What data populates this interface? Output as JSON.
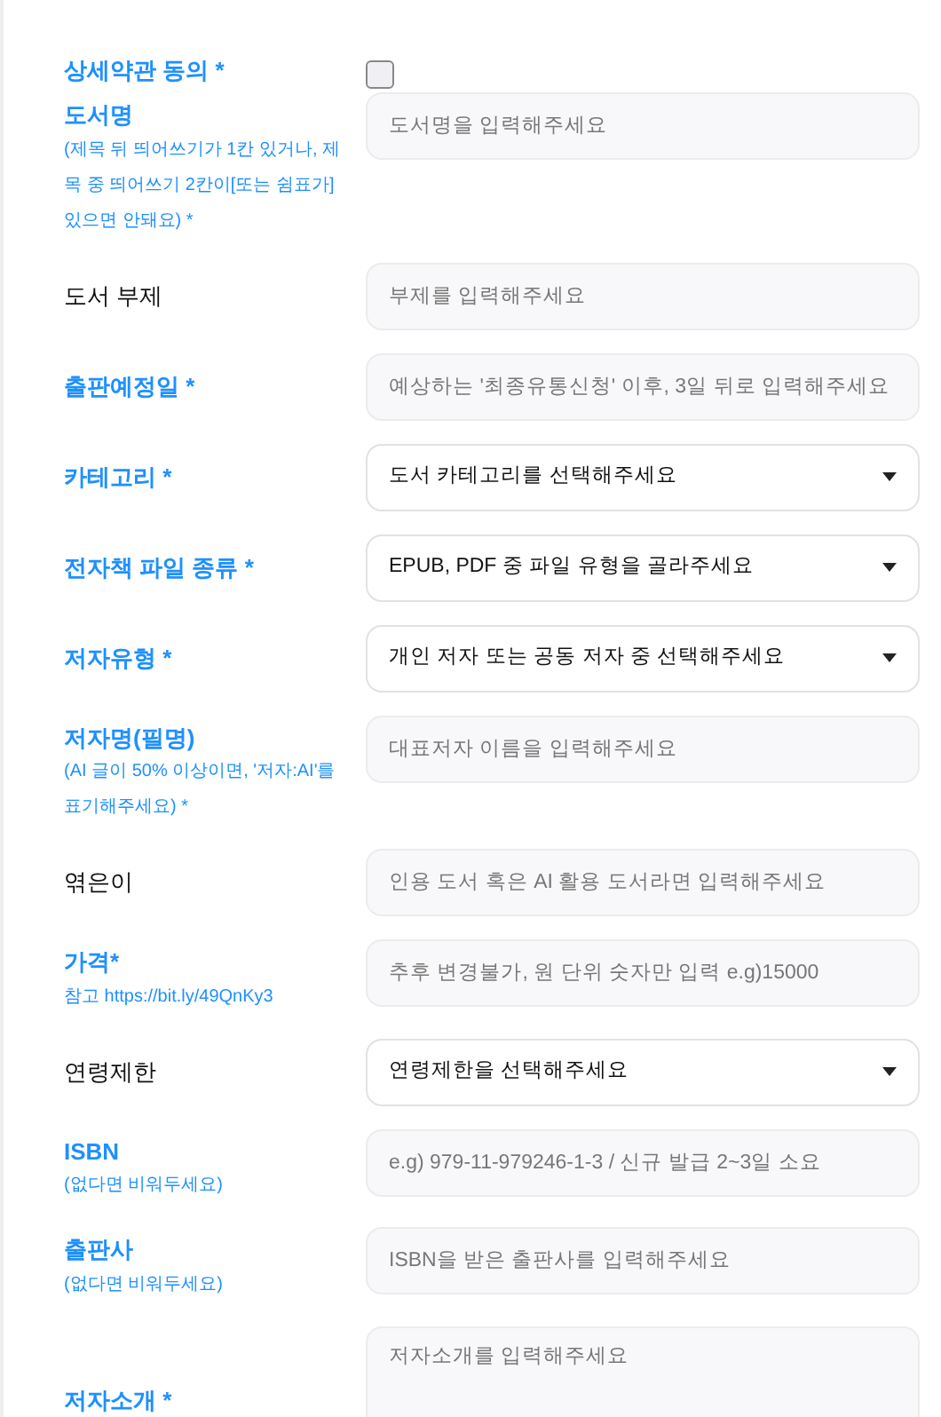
{
  "fields": [
    {
      "label": "상세약관 동의 *",
      "highlight": true,
      "kind": "checkbox",
      "checked": false
    },
    {
      "label": "도서명",
      "highlight": true,
      "hint": "(제목 뒤 띄어쓰기가 1칸 있거나, 제목 중 띄어쓰기 2칸이[또는 쉼표가] 있으면 안돼요) *",
      "kind": "input",
      "placeholder": "도서명을 입력해주세요"
    },
    {
      "label": "도서 부제",
      "highlight": false,
      "kind": "input",
      "placeholder": "부제를 입력해주세요"
    },
    {
      "label": "출판예정일 *",
      "highlight": true,
      "kind": "input",
      "placeholder": "예상하는 '최종유통신청' 이후, 3일 뒤로 입력해주세요"
    },
    {
      "label": "카테고리 *",
      "highlight": true,
      "kind": "select",
      "value": "도서 카테고리를 선택해주세요"
    },
    {
      "label": "전자책 파일 종류 *",
      "highlight": true,
      "kind": "select",
      "value": "EPUB, PDF 중 파일 유형을 골라주세요"
    },
    {
      "label": "저자유형 *",
      "highlight": true,
      "kind": "select",
      "value": "개인 저자 또는 공동 저자 중 선택해주세요"
    },
    {
      "label": "저자명(필명)",
      "highlight": true,
      "hint": "(AI 글이 50% 이상이면, '저자:AI'를 표기해주세요) *",
      "kind": "input",
      "placeholder": "대표저자 이름을 입력해주세요"
    },
    {
      "label": "엮은이",
      "highlight": false,
      "kind": "input",
      "placeholder": "인용 도서 혹은 AI 활용 도서라면 입력해주세요"
    },
    {
      "label": "가격*",
      "highlight": true,
      "hint": "참고 https://bit.ly/49QnKy3",
      "kind": "input",
      "placeholder": "추후 변경불가, 원 단위 숫자만 입력 e.g)15000"
    },
    {
      "label": "연령제한",
      "highlight": false,
      "kind": "select",
      "value": "연령제한을 선택해주세요"
    },
    {
      "label": "ISBN",
      "highlight": true,
      "hint": "(없다면 비워두세요)",
      "kind": "input",
      "placeholder": "e.g) 979-11-979246-1-3 / 신규 발급 2~3일 소요"
    },
    {
      "label": "출판사",
      "highlight": true,
      "hint": "(없다면 비워두세요)",
      "kind": "input",
      "placeholder": "ISBN을 받은 출판사를 입력해주세요"
    },
    {
      "label": "저자소개 *",
      "highlight": true,
      "kind": "textarea",
      "placeholder": "저자소개를 입력해주세요"
    }
  ]
}
